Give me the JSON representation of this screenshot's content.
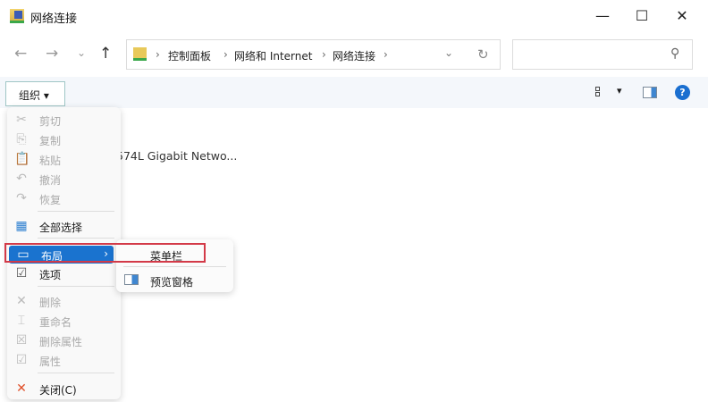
{
  "window": {
    "title": "网络连接",
    "icon": "network-connections-icon"
  },
  "nav": {
    "back": "←",
    "forward": "→",
    "recent": "⌄",
    "up": "↑"
  },
  "address": {
    "crumbs": [
      "控制面板",
      "网络和 Internet",
      "网络连接"
    ],
    "separator": "›",
    "dropdown": "⌄",
    "refresh": "↻"
  },
  "search": {
    "placeholder": "",
    "icon": "⚲"
  },
  "toolbar": {
    "organize": "组织 ▾",
    "view_icon": "view-icon",
    "view_dropdown": "▾",
    "help": "?"
  },
  "content": {
    "item_text": "574L Gigabit Netwo..."
  },
  "menu": {
    "items": [
      {
        "label": "剪切",
        "icon": "✂",
        "disabled": true
      },
      {
        "label": "复制",
        "icon": "⎘",
        "disabled": true
      },
      {
        "label": "粘贴",
        "icon": "📋",
        "disabled": true
      },
      {
        "label": "撤消",
        "icon": "↶",
        "disabled": true
      },
      {
        "label": "恢复",
        "icon": "↷",
        "disabled": true
      },
      {
        "label": "全部选择",
        "icon": "▦",
        "disabled": false
      },
      {
        "label": "布局",
        "icon": "▭",
        "disabled": false,
        "submenu_arrow": "›"
      },
      {
        "label": "选项",
        "icon": "☑",
        "disabled": false
      },
      {
        "label": "删除",
        "icon": "✕",
        "disabled": true
      },
      {
        "label": "重命名",
        "icon": "⌶",
        "disabled": true
      },
      {
        "label": "删除属性",
        "icon": "☒",
        "disabled": true
      },
      {
        "label": "属性",
        "icon": "☑",
        "disabled": true
      },
      {
        "label": "关闭(C)",
        "icon": "✕",
        "disabled": false
      }
    ]
  },
  "submenu": {
    "items": [
      {
        "label": "菜单栏"
      },
      {
        "label": "预览窗格",
        "icon": "preview-pane-icon"
      }
    ]
  },
  "colors": {
    "highlight": "#1a73cf",
    "annotation": "#d33a48",
    "close_icon": "#e0502a"
  }
}
